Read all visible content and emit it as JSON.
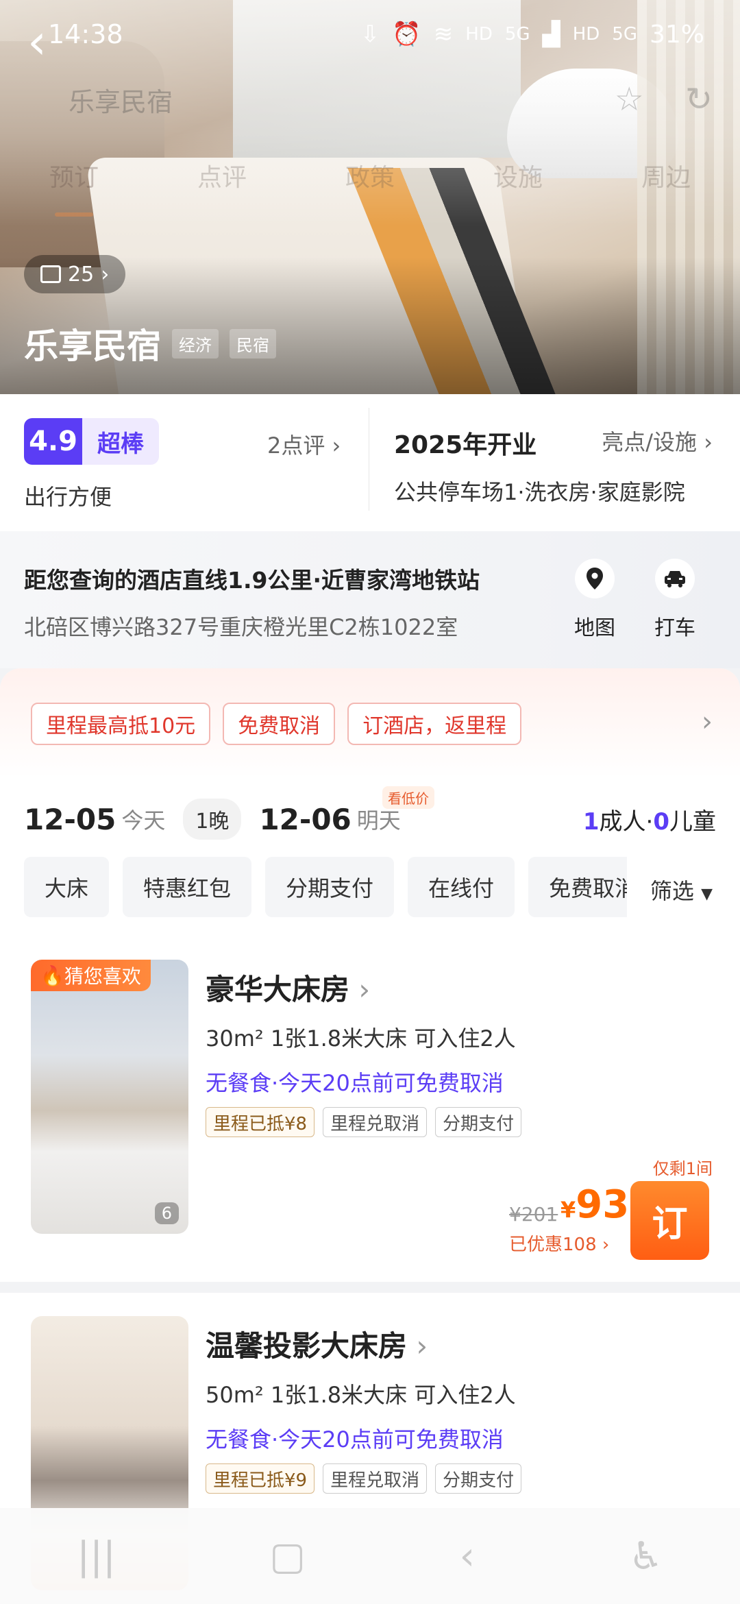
{
  "status": {
    "time": "14:38",
    "battery": "31%",
    "net1": "HD",
    "net2": "5G",
    "net3": "HD",
    "net4": "5G"
  },
  "header": {
    "title_faded": "乐享民宿",
    "tabs": [
      "预订",
      "点评",
      "政策",
      "设施",
      "周边"
    ]
  },
  "hero": {
    "photo_count": "25",
    "hotel_name": "乐享民宿",
    "tags": [
      "经济",
      "民宿"
    ]
  },
  "rating": {
    "score": "4.9",
    "label": "超棒",
    "reviews": "2点评",
    "subtitle": "出行方便",
    "opened": "2025年开业",
    "highlights_link": "亮点/设施",
    "facilities": "公共停车场1·洗衣房·家庭影院"
  },
  "location": {
    "main": "距您查询的酒店直线1.9公里·近曹家湾地铁站",
    "address": "北碚区博兴路327号重庆橙光里C2栋1022室",
    "map_label": "地图",
    "taxi_label": "打车"
  },
  "promos": [
    "里程最高抵10元",
    "免费取消",
    "订酒店，返里程"
  ],
  "dates": {
    "checkin": "12-05",
    "checkin_sub": "今天",
    "nights": "1晚",
    "checkout": "12-06",
    "checkout_sub": "明天",
    "lowprice_badge": "看低价",
    "adults": "1",
    "adults_label": "成人·",
    "children": "0",
    "children_label": "儿童"
  },
  "filters": {
    "chips": [
      "大床",
      "特惠红包",
      "分期支付",
      "在线付",
      "免费取消"
    ],
    "filter_label": "筛选"
  },
  "rooms": [
    {
      "badge": "猜您喜欢",
      "img_count": "6",
      "title": "豪华大床房",
      "spec": "30m²  1张1.8米大床  可入住2人",
      "policy": "无餐食·今天20点前可免费取消",
      "tags": [
        "里程已抵¥8",
        "里程兑取消",
        "分期支付"
      ],
      "remain": "仅剩1间",
      "old_price": "¥201",
      "currency": "¥",
      "price": "93",
      "saved": "已优惠108",
      "book": "订"
    },
    {
      "title": "温馨投影大床房",
      "spec": "50m²  1张1.8米大床  可入住2人",
      "policy": "无餐食·今天20点前可免费取消",
      "tags": [
        "里程已抵¥9",
        "里程兑取消",
        "分期支付"
      ]
    }
  ],
  "colors": {
    "brand_purple": "#5b3df5",
    "accent_orange": "#ff6a00",
    "promo_red": "#e0372c"
  }
}
